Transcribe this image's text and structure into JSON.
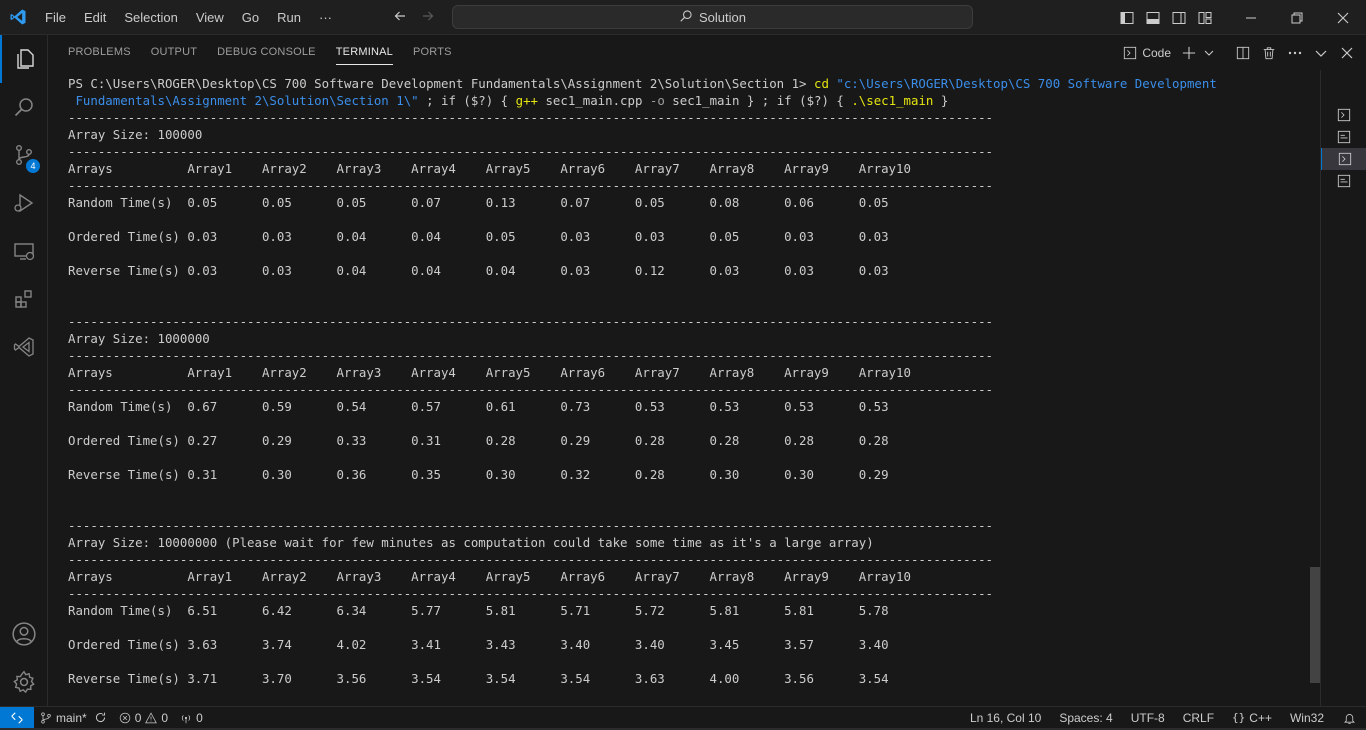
{
  "titlebar": {
    "menu": [
      "File",
      "Edit",
      "Selection",
      "View",
      "Go",
      "Run",
      "···"
    ],
    "search_text": "Solution"
  },
  "activitybar": {
    "icons": [
      "explorer-icon",
      "search-icon",
      "source-control-icon",
      "run-debug-icon",
      "remote-explorer-icon",
      "extensions-icon",
      "visual-studio-icon"
    ],
    "source_control_badge": "4"
  },
  "panel": {
    "tabs": [
      "PROBLEMS",
      "OUTPUT",
      "DEBUG CONSOLE",
      "TERMINAL",
      "PORTS"
    ],
    "active_tab": "TERMINAL",
    "terminal_profile_label": "Code"
  },
  "terminal": {
    "prompt": "PS C:\\Users\\ROGER\\Desktop\\CS 700 Software Development Fundamentals\\Assignment 2\\Solution\\Section 1> ",
    "cmd_cd": "cd",
    "cmd_path_1": " \"c:\\Users\\ROGER\\Desktop\\CS 700 Software Development",
    "cmd_path_2": " Fundamentals\\Assignment 2\\Solution\\Section 1\\\"",
    "cmd_rest_1": " ; if ($?) { ",
    "cmd_gpp": "g++",
    "cmd_rest_2": " sec1_main.cpp ",
    "cmd_flag": "-o",
    "cmd_rest_3": " sec1_main } ; if ($?) { ",
    "cmd_run": ".\\sec1_main",
    "cmd_rest_4": " }",
    "separator": "---------------------------------------------------------------------------------------------------------------------------------------------------",
    "header_row": [
      "Arrays",
      "Array1",
      "Array2",
      "Array3",
      "Array4",
      "Array5",
      "Array6",
      "Array7",
      "Array8",
      "Array9",
      "Array10"
    ],
    "blocks": [
      {
        "title": "Array Size: 100000",
        "rows": [
          {
            "label": "Random Time(s)",
            "values": [
              "0.05",
              "0.05",
              "0.05",
              "0.07",
              "0.13",
              "0.07",
              "0.05",
              "0.08",
              "0.06",
              "0.05"
            ]
          },
          {
            "label": "Ordered Time(s)",
            "values": [
              "0.03",
              "0.03",
              "0.04",
              "0.04",
              "0.05",
              "0.03",
              "0.03",
              "0.05",
              "0.03",
              "0.03"
            ]
          },
          {
            "label": "Reverse Time(s)",
            "values": [
              "0.03",
              "0.03",
              "0.04",
              "0.04",
              "0.04",
              "0.03",
              "0.12",
              "0.03",
              "0.03",
              "0.03"
            ]
          }
        ]
      },
      {
        "title": "Array Size: 1000000",
        "rows": [
          {
            "label": "Random Time(s)",
            "values": [
              "0.67",
              "0.59",
              "0.54",
              "0.57",
              "0.61",
              "0.73",
              "0.53",
              "0.53",
              "0.53",
              "0.53"
            ]
          },
          {
            "label": "Ordered Time(s)",
            "values": [
              "0.27",
              "0.29",
              "0.33",
              "0.31",
              "0.28",
              "0.29",
              "0.28",
              "0.28",
              "0.28",
              "0.28"
            ]
          },
          {
            "label": "Reverse Time(s)",
            "values": [
              "0.31",
              "0.30",
              "0.36",
              "0.35",
              "0.30",
              "0.32",
              "0.28",
              "0.30",
              "0.30",
              "0.29"
            ]
          }
        ]
      },
      {
        "title": "Array Size: 10000000 (Please wait for few minutes as computation could take some time as it's a large array)",
        "rows": [
          {
            "label": "Random Time(s)",
            "values": [
              "6.51",
              "6.42",
              "6.34",
              "5.77",
              "5.81",
              "5.71",
              "5.72",
              "5.81",
              "5.81",
              "5.78"
            ]
          },
          {
            "label": "Ordered Time(s)",
            "values": [
              "3.63",
              "3.74",
              "4.02",
              "3.41",
              "3.43",
              "3.40",
              "3.40",
              "3.45",
              "3.57",
              "3.40"
            ]
          },
          {
            "label": "Reverse Time(s)",
            "values": [
              "3.71",
              "3.70",
              "3.56",
              "3.54",
              "3.54",
              "3.54",
              "3.63",
              "4.00",
              "3.56",
              "3.54"
            ]
          }
        ]
      }
    ]
  },
  "statusbar": {
    "branch": "main*",
    "errors": "0",
    "warnings": "0",
    "ports": "0",
    "position": "Ln 16, Col 10",
    "spaces": "Spaces: 4",
    "encoding": "UTF-8",
    "eol": "CRLF",
    "language": "C++",
    "platform": "Win32"
  },
  "colors": {
    "accent": "#0078d4",
    "background": "#181818",
    "terminal_yellow": "#e5e510",
    "terminal_cyan": "#3b8eea"
  }
}
